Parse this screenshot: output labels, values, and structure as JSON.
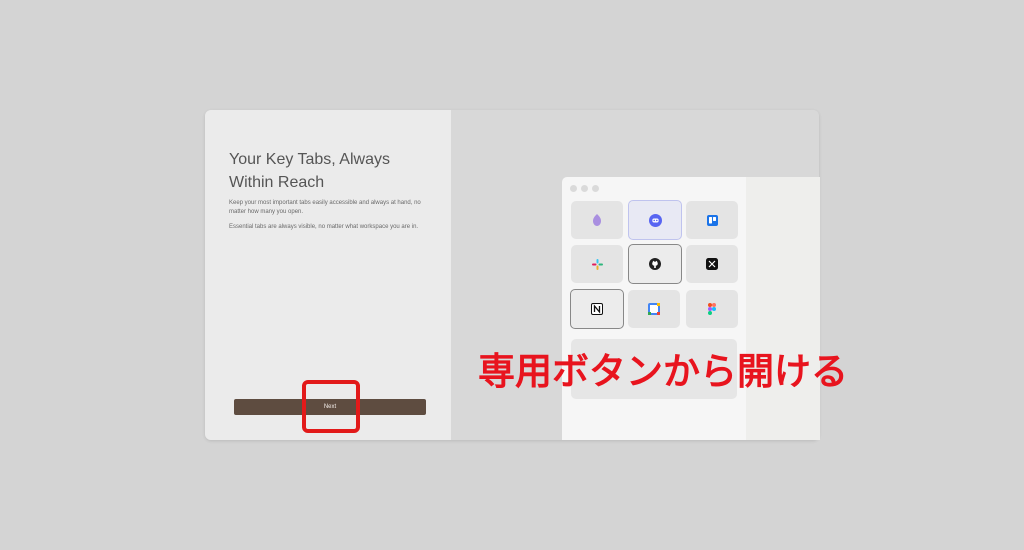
{
  "onboarding": {
    "title": "Your Key Tabs, Always Within Reach",
    "description_1": "Keep your most important tabs easily accessible and always at hand, no matter how many you open.",
    "description_2": "Essential tabs are always visible, no matter what workspace you are in.",
    "next_label": "Next"
  },
  "preview": {
    "tiles": [
      {
        "icon": "ai-assistant-icon",
        "state": "normal"
      },
      {
        "icon": "discord-icon",
        "state": "selected"
      },
      {
        "icon": "trello-icon",
        "state": "normal"
      },
      {
        "icon": "slack-icon",
        "state": "normal"
      },
      {
        "icon": "github-icon",
        "state": "selected"
      },
      {
        "icon": "x-twitter-icon",
        "state": "normal"
      },
      {
        "icon": "notion-icon",
        "state": "selected"
      },
      {
        "icon": "google-calendar-icon",
        "state": "normal"
      },
      {
        "icon": "figma-icon",
        "state": "normal"
      }
    ]
  },
  "annotation": {
    "caption": "専用ボタンから開ける",
    "highlight_color": "#e21a1a"
  },
  "colors": {
    "next_button": "#5e4c40",
    "background": "#d4d4d4"
  }
}
